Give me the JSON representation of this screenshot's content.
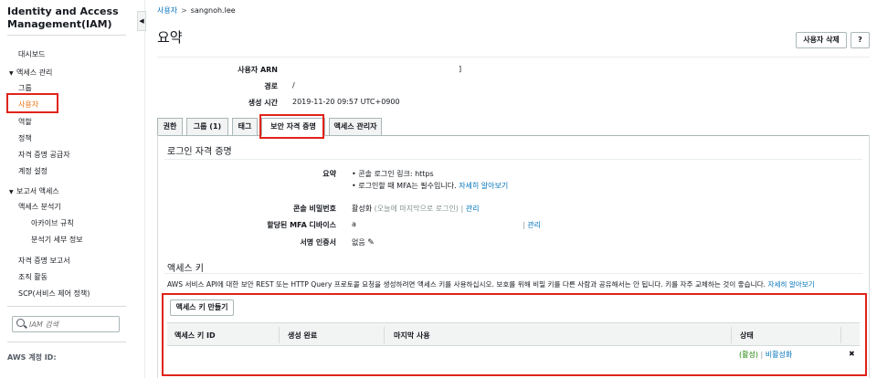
{
  "sidebar": {
    "title_line1": "Identity and Access",
    "title_line2": "Management(IAM)",
    "items": [
      {
        "label": "대시보드"
      },
      {
        "label": "액세스 관리"
      },
      {
        "label": "그룹"
      },
      {
        "label": "사용자"
      },
      {
        "label": "역할"
      },
      {
        "label": "정책"
      },
      {
        "label": "자격 증명 공급자"
      },
      {
        "label": "계정 설정"
      },
      {
        "label": "보고서 액세스"
      },
      {
        "label": "액세스 분석기"
      },
      {
        "label": "아카이브 규칙"
      },
      {
        "label": "분석기 세부 정보"
      },
      {
        "label": "자격 증명 보고서"
      },
      {
        "label": "조직 활동"
      },
      {
        "label": "SCP(서비스 제어 정책)"
      }
    ],
    "search_placeholder": "IAM 검색",
    "account_label": "AWS 계정 ID:",
    "collapse_glyph": "◀"
  },
  "breadcrumb": {
    "parent": "사용자",
    "separator": ">",
    "current": "sangnoh.lee"
  },
  "header": {
    "title": "요약",
    "delete_button": "사용자 삭제",
    "help_button": "?"
  },
  "summary": {
    "arn_label": "사용자 ARN",
    "arn_value": "]",
    "path_label": "경로",
    "path_value": "/",
    "created_label": "생성 시간",
    "created_value": "2019-11-20 09:57 UTC+0900"
  },
  "tabs": [
    {
      "label": "권한"
    },
    {
      "label": "그룹 (1)"
    },
    {
      "label": "태그"
    },
    {
      "label": "보안 자격 증명"
    },
    {
      "label": "액세스 관리자"
    }
  ],
  "signin": {
    "title": "로그인 자격 증명",
    "summary_label": "요약",
    "bullet1": "• 콘솔 로그인 링크: https",
    "bullet2": "• 로그인할 때 MFA는 필수입니다.",
    "bullet2_link": "자세히 알아보기",
    "console_pw_label": "콘솔 비밀번호",
    "console_pw_value": "활성화",
    "console_pw_note": "(오늘에 마지막으로 로그인)",
    "console_pw_sep": "|",
    "console_pw_link": "관리",
    "mfa_label": "할당된 MFA 디바이스",
    "mfa_value": "a",
    "mfa_sep": "|",
    "mfa_link": "관리",
    "signing_label": "서명 인증서",
    "signing_value": "없음"
  },
  "access_keys": {
    "title": "액세스 키",
    "description": "AWS 서비스 API에 대한 보안 REST 또는 HTTP Query 프로토콜 요청을 생성하려면 액세스 키를 사용하십시오. 보호를 위해 비밀 키를 다른 사람과 공유해서는 안 됩니다. 키를 자주 교체하는 것이 좋습니다.",
    "learn_more": "자세히 알아보기",
    "create_button": "액세스 키 만들기",
    "columns": [
      "액세스 키 ID",
      "생성 완료",
      "마지막 사용",
      "상태"
    ],
    "row": {
      "status": "(활성)",
      "sep": "|",
      "deactivate": "비활성화",
      "delete_glyph": "✖"
    }
  },
  "colors": {
    "accent": "#ec7211",
    "link": "#0073bb",
    "highlight": "#e0231b",
    "active_green": "#1d8102"
  }
}
